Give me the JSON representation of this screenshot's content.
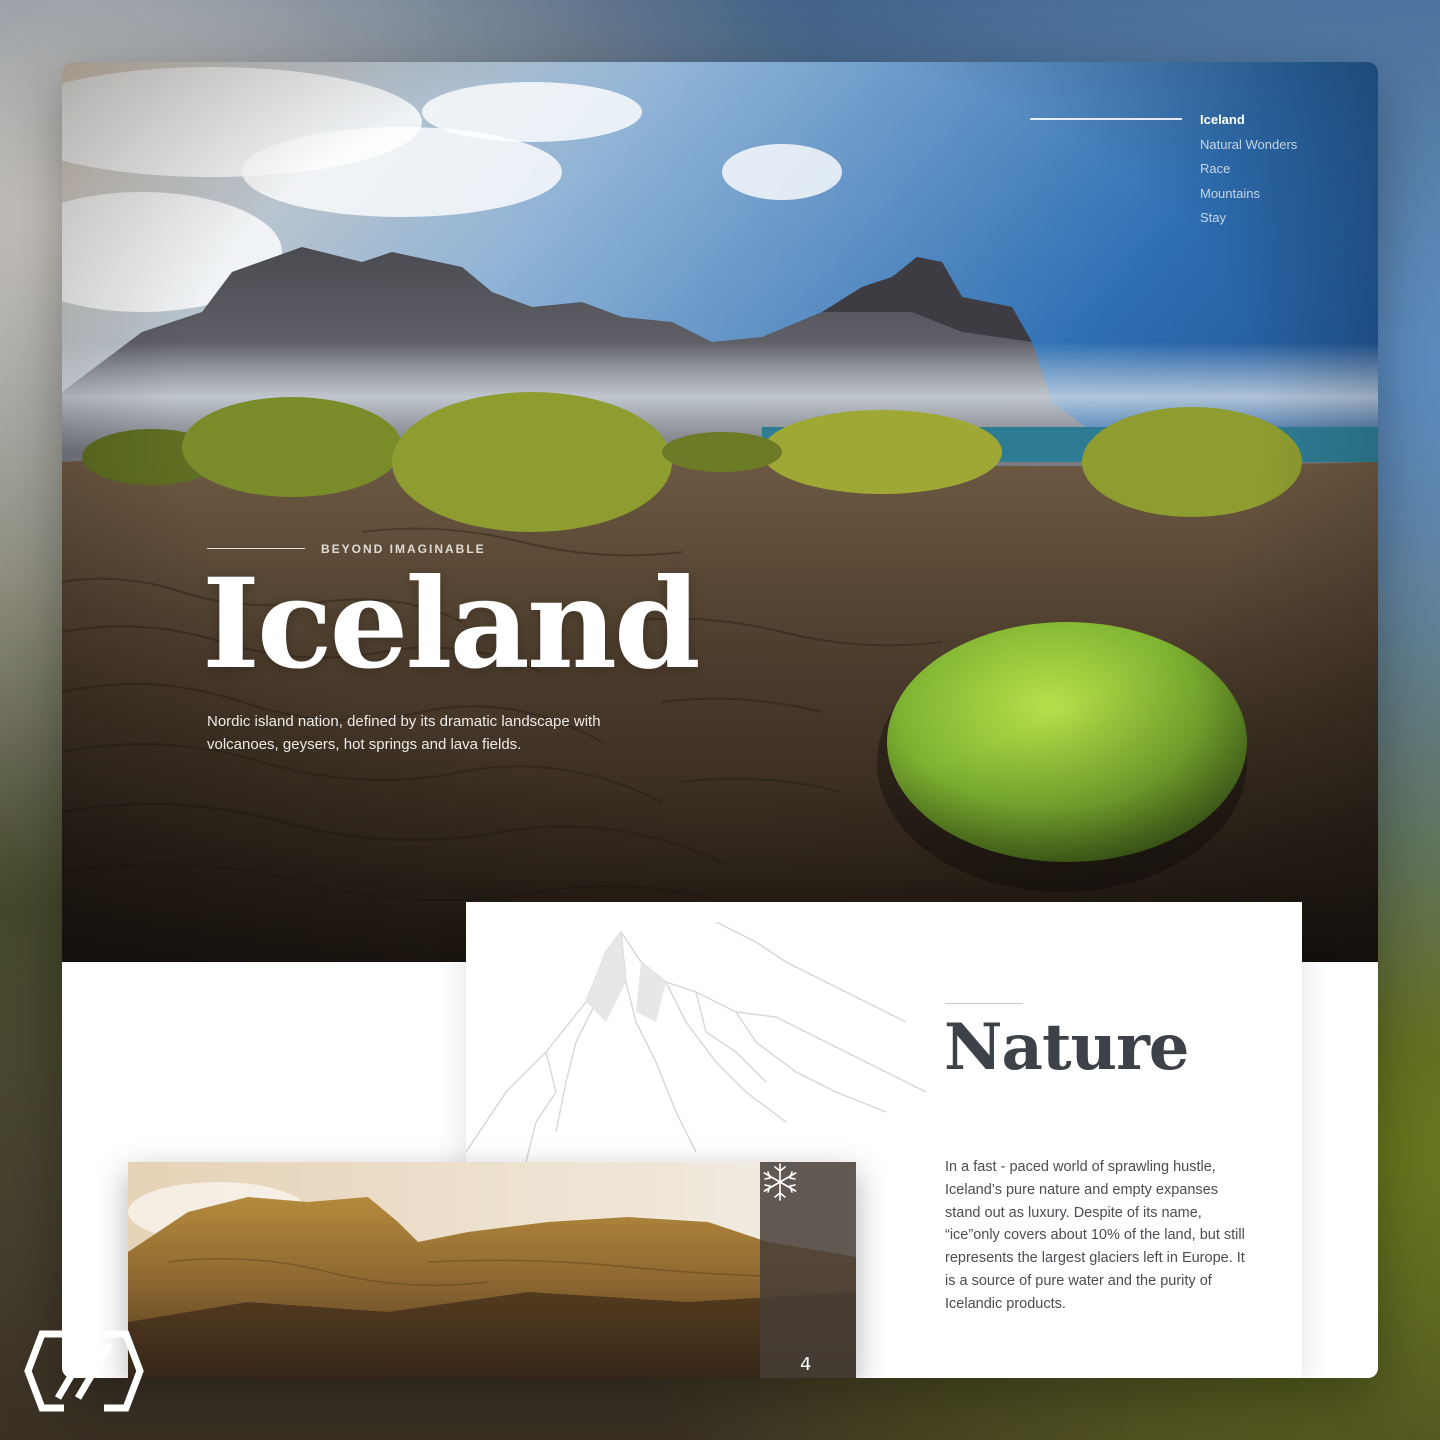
{
  "nav": {
    "items": [
      {
        "label": "Iceland",
        "active": true
      },
      {
        "label": "Natural Wonders",
        "active": false
      },
      {
        "label": "Race",
        "active": false
      },
      {
        "label": "Mountains",
        "active": false
      },
      {
        "label": "Stay",
        "active": false
      }
    ]
  },
  "hero": {
    "eyebrow": "BEYOND IMAGINABLE",
    "title": "Iceland",
    "description": "Nordic island nation, defined by its dramatic landscape with volcanoes, geysers, hot springs and lava fields."
  },
  "nature": {
    "title": "Nature",
    "body": "In a fast - paced world of sprawling hustle, Iceland’s pure nature and empty expanses stand out as luxury. Despite of its name, “ice”only covers about 10% of the land, but still represents the largest glaciers left in Europe. It is a source of pure water and the purity of Icelandic products."
  },
  "gallery": {
    "icon": "snowflake-icon",
    "counter": "4"
  },
  "brand": {
    "logo_icon": "hexagon-logo-icon"
  },
  "colors": {
    "title_dark": "#3d4148",
    "body_text": "#4a4d52",
    "nav_active": "#ffffff",
    "moss_green": "#8cc63f"
  }
}
